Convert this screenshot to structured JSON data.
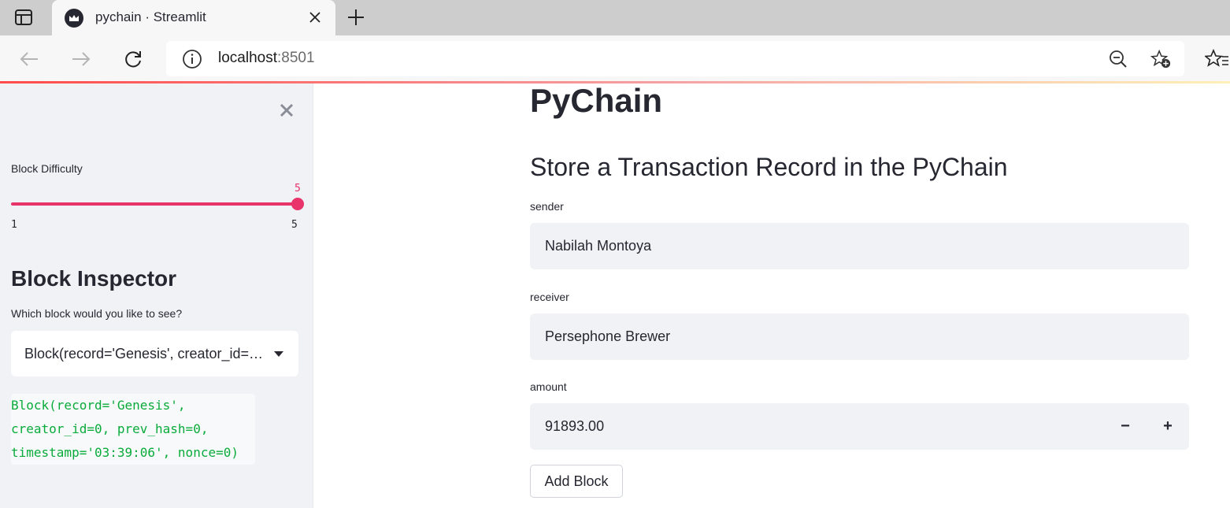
{
  "browser": {
    "tab_title": "pychain · Streamlit",
    "address_host": "localhost",
    "address_port": ":8501"
  },
  "sidebar": {
    "slider": {
      "label": "Block Difficulty",
      "value": "5",
      "min": "1",
      "max": "5"
    },
    "heading": "Block Inspector",
    "select": {
      "label": "Which block would you like to see?",
      "value": "Block(record='Genesis', creator_id=0, prev_hash=0, timestamp='03:39:06', nonce=0)"
    },
    "code_lines": [
      "Block(record='Genesis',",
      "creator_id=0, prev_hash=0,",
      "timestamp='03:39:06', nonce=0)"
    ]
  },
  "main": {
    "title": "PyChain",
    "subheading": "Store a Transaction Record in the PyChain",
    "fields": {
      "sender": {
        "label": "sender",
        "value": "Nabilah Montoya"
      },
      "receiver": {
        "label": "receiver",
        "value": "Persephone Brewer"
      },
      "amount": {
        "label": "amount",
        "value": "91893.00",
        "decrement": "−",
        "increment": "+"
      }
    },
    "add_button": "Add Block"
  },
  "colors": {
    "accent": "#e8336b",
    "code_text": "#09ab3b",
    "sidebar_bg": "#f0f2f6"
  }
}
